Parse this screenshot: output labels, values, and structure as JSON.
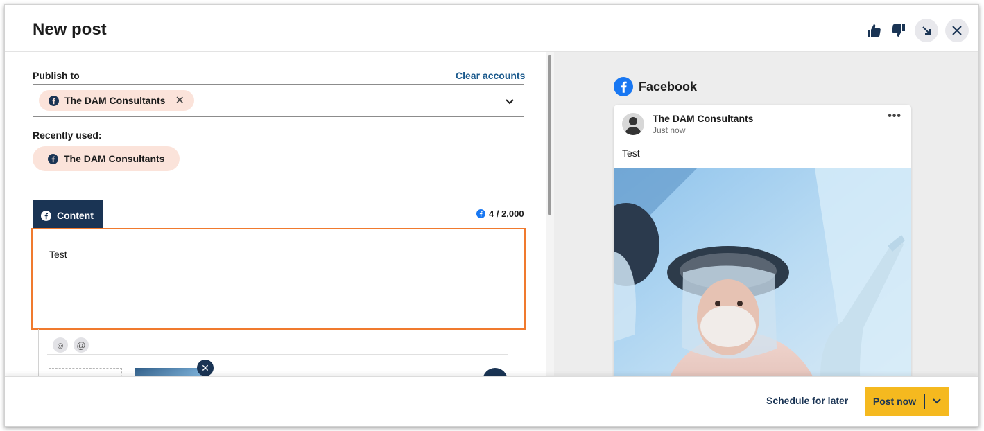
{
  "header": {
    "title": "New post",
    "icons": [
      "thumbs-up-icon",
      "thumbs-down-icon",
      "minimize-icon",
      "close-icon"
    ]
  },
  "publish": {
    "label": "Publish to",
    "clear_label": "Clear accounts",
    "selected_account": "The DAM Consultants",
    "recent_label": "Recently used:",
    "recent_account": "The DAM Consultants"
  },
  "content": {
    "tab_label": "Content",
    "counter": "4 / 2,000",
    "text": "Test"
  },
  "preview": {
    "network": "Facebook",
    "account_name": "The DAM Consultants",
    "timestamp": "Just now",
    "post_text": "Test",
    "more": "•••"
  },
  "footer": {
    "schedule_label": "Schedule for later",
    "post_label": "Post now"
  },
  "colors": {
    "accent_orange": "#f07a2e",
    "navy": "#1a3454",
    "link_blue": "#1b5a8d",
    "chip_bg": "#fbe3da",
    "post_button": "#f5b91f",
    "facebook_blue": "#1877f2"
  }
}
